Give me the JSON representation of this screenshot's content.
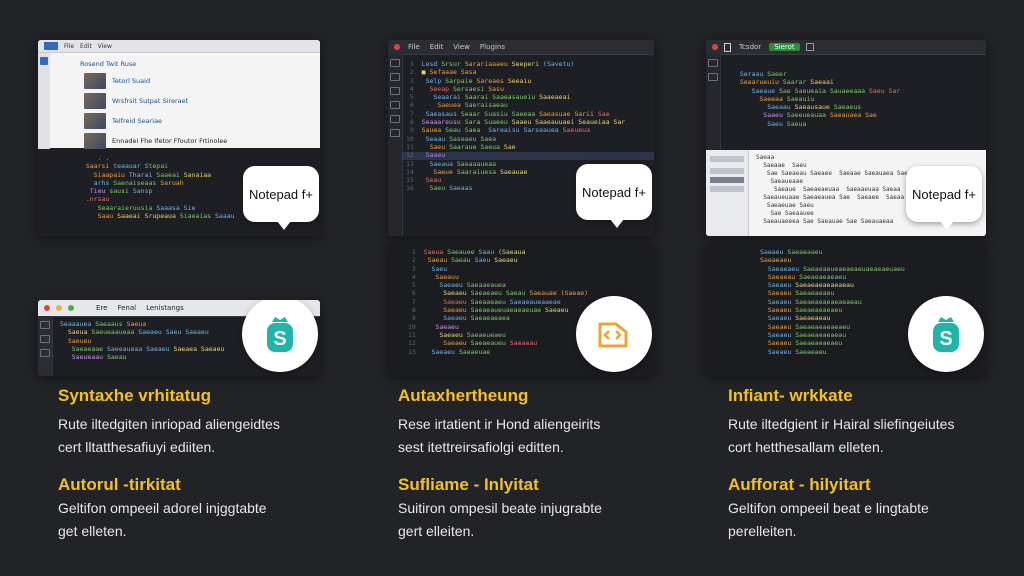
{
  "panels": {
    "left_top": {
      "menu": [
        "File",
        "Edit",
        "View"
      ],
      "chat_lines": [
        "Rosend Twit Ruse",
        "Tetorl Suaid",
        "Wrsfrsit Sutpat Sireraet",
        "Telfreid Seariae",
        "Ennadei Fhe Ifetor Ffoutor Frtinolee"
      ],
      "bubble_label": "Notepad f+"
    },
    "center_top": {
      "menu": [
        "File",
        "Edit",
        "View",
        "Plugins"
      ],
      "bubble_label": "Notepad f+"
    },
    "right_top": {
      "title": "Tcsdor",
      "menu_button": "Sierot",
      "bubble_label": "Notepad f+"
    },
    "left_bottom": {
      "menu": [
        "Ere",
        "Fenal",
        "Lenistangs"
      ],
      "icon": "shopping-bag-icon"
    },
    "center_bottom": {
      "icon": "code-tag-icon"
    },
    "right_bottom": {
      "icon": "shopping-bag-icon"
    }
  },
  "features": [
    {
      "title": "Syntaxhe vrhitatug",
      "lines": [
        "Rute iltedgiten inriopad aliengeidtes",
        "cert lltatthesafiuyi ediiten."
      ],
      "subtitle": "Autorul -tirkitat",
      "sublines": [
        "Geltifon ompeeil adorel injggtabte",
        "get elleten."
      ]
    },
    {
      "title": "Autaxhertheung",
      "lines": [
        "Rese irtatient ir Hond aliengeirits",
        "sest itettreirsafiolgi editten."
      ],
      "subtitle": "Sufliame - Inlyitat",
      "sublines": [
        "Suitiron ompesil beate injugrabte",
        "gert elleiten."
      ]
    },
    {
      "title": "Infiant- wrkkate",
      "lines": [
        "Rute iltedgient ir Hairal sliefingeiutes",
        "cort hetthesallam elleten."
      ],
      "subtitle": "Aufforat - hilyitart",
      "sublines": [
        "Geltifon ompeeil beat e lingtabte",
        "perelleiten."
      ]
    }
  ],
  "colors": {
    "accent": "#f4c21f",
    "teal": "#1fb5a8",
    "orange": "#f0a232",
    "background": "#222327"
  }
}
